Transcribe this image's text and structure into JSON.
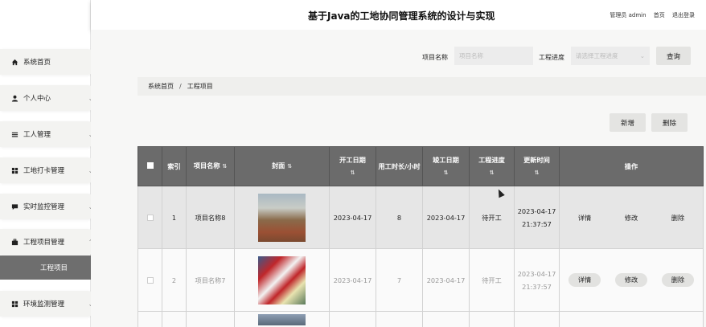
{
  "header": {
    "title": "基于Java的工地协同管理系统的设计与实现",
    "user": "管理员 admin",
    "home_link": "首页",
    "logout": "退出登录"
  },
  "sidebar": {
    "items": [
      {
        "label": "系统首页",
        "icon": "home-icon",
        "has_chevron": false
      },
      {
        "label": "个人中心",
        "icon": "user-icon",
        "has_chevron": true
      },
      {
        "label": "工人管理",
        "icon": "list-icon",
        "has_chevron": true
      },
      {
        "label": "工地打卡管理",
        "icon": "grid-icon",
        "has_chevron": true
      },
      {
        "label": "实时监控管理",
        "icon": "chat-icon",
        "has_chevron": true
      },
      {
        "label": "工程项目管理",
        "icon": "briefcase-icon",
        "has_chevron": true,
        "expanded": true
      },
      {
        "label": "环境监测管理",
        "icon": "grid-icon",
        "has_chevron": true
      }
    ],
    "active_sub": "工程项目"
  },
  "search": {
    "name_label": "项目名称",
    "name_placeholder": "项目名称",
    "progress_label": "工程进度",
    "progress_placeholder": "请选择工程进度",
    "query_button": "查询"
  },
  "breadcrumb": {
    "home": "系统首页",
    "current": "工程项目"
  },
  "toolbar": {
    "add": "新增",
    "delete": "删除"
  },
  "table": {
    "headers": {
      "index": "索引",
      "name": "项目名称",
      "cover": "封面",
      "start": "开工日期",
      "duration": "用工时长/小时",
      "end": "竣工日期",
      "progress": "工程进度",
      "updated": "更新时间",
      "ops": "操作"
    },
    "rows": [
      {
        "index": "1",
        "name": "项目名称8",
        "start": "2023-04-17",
        "duration": "8",
        "end": "2023-04-17",
        "progress": "待开工",
        "updated": "2023-04-17 21:37:57"
      },
      {
        "index": "2",
        "name": "项目名称7",
        "start": "2023-04-17",
        "duration": "7",
        "end": "2023-04-17",
        "progress": "待开工",
        "updated": "2023-04-17 21:37:57"
      }
    ],
    "op_labels": {
      "detail": "详情",
      "edit": "修改",
      "delete": "删除"
    }
  },
  "colors": {
    "table_header": "#6b6b6b",
    "active_submenu": "#6e6e6e",
    "sidebar_pill": "#f3f3f1"
  }
}
